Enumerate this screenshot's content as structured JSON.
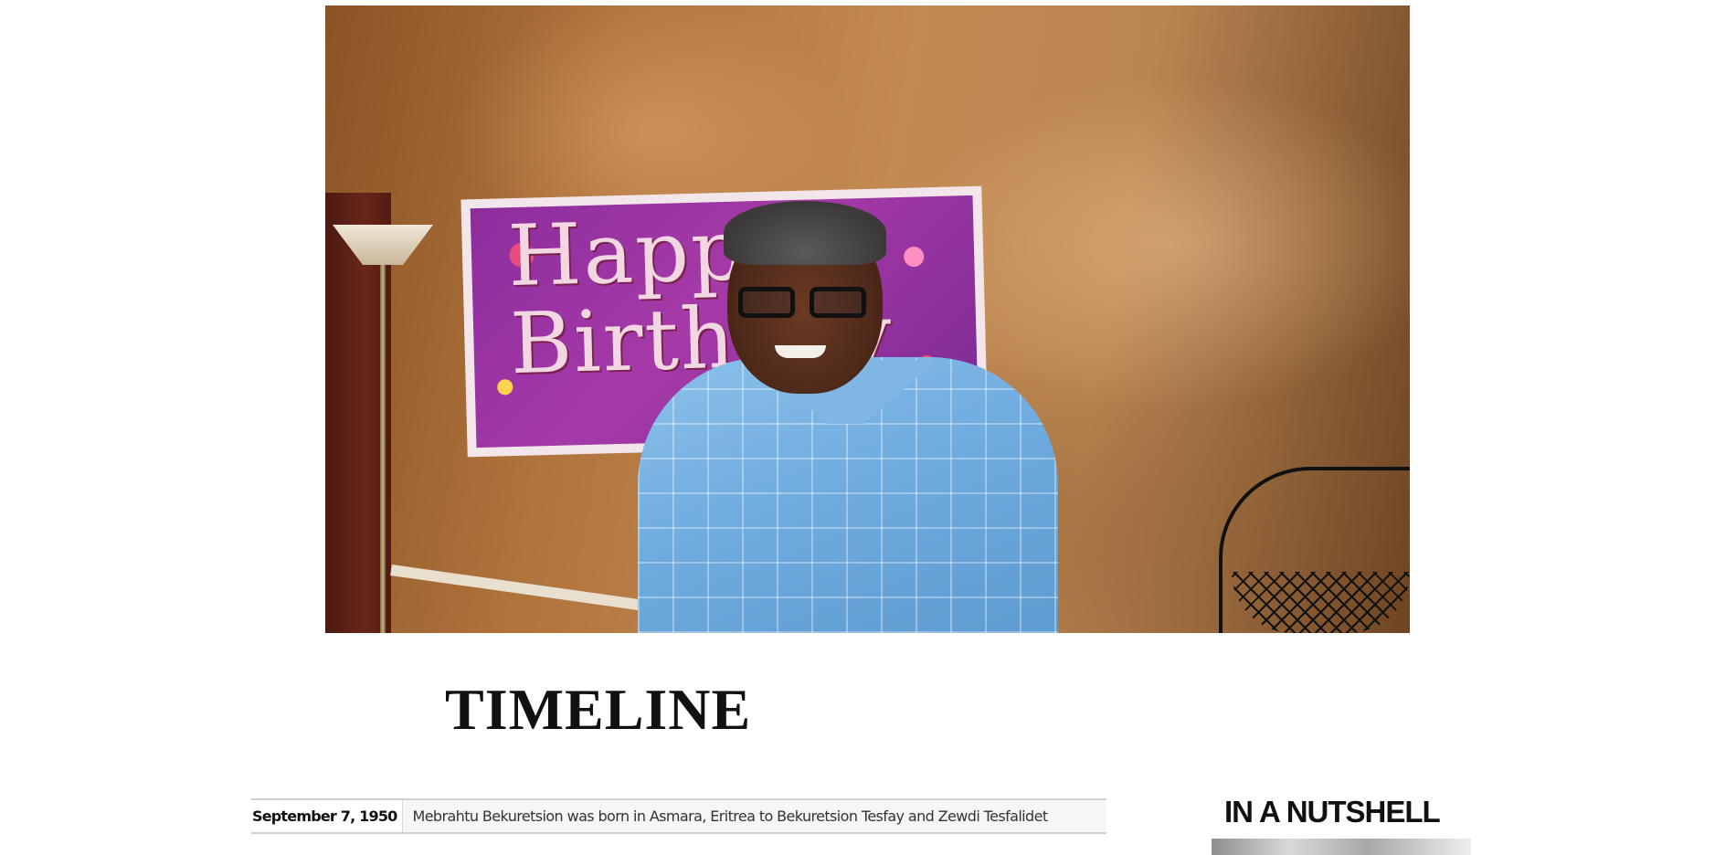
{
  "hero": {
    "banner_text_line1": "Happy",
    "banner_text_line2": "Birthday"
  },
  "timeline": {
    "heading": "TIMELINE",
    "entries": [
      {
        "date": "September 7, 1950",
        "event": "Mebrahtu Bekuretsion was born in Asmara, Eritrea to Bekuretsion Tesfay and Zewdi Tesfalidet"
      }
    ]
  },
  "sidebar": {
    "nutshell_heading": "IN A NUTSHELL"
  }
}
